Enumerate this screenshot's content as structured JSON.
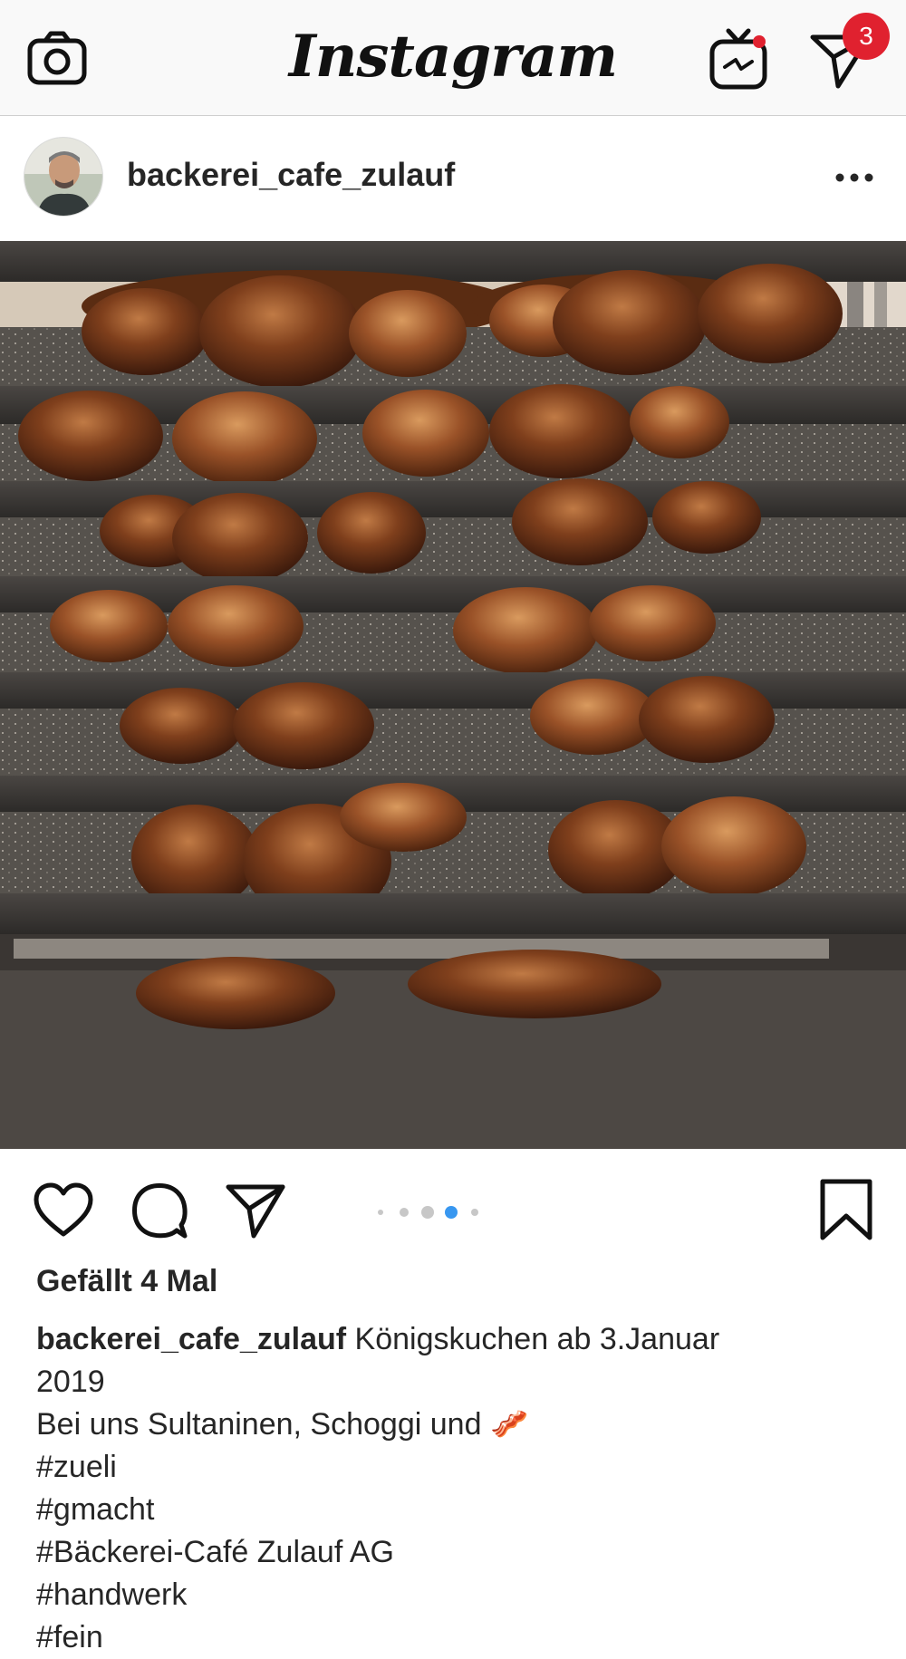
{
  "app": {
    "title": "Instagram",
    "notification_count": "3",
    "colors": {
      "badge": "#e0212f",
      "active_dot": "#3897f0",
      "text": "#262626"
    }
  },
  "icons": {
    "camera": "camera-icon",
    "igtv": "igtv-icon",
    "direct": "paper-plane-icon",
    "more": "more-dots-icon",
    "like": "heart-icon",
    "comment": "comment-bubble-icon",
    "share": "paper-plane-icon",
    "save": "bookmark-icon"
  },
  "post": {
    "username": "backerei_cafe_zulauf",
    "carousel": {
      "total": 5,
      "active_index": 3
    },
    "likes": "Gefällt 4 Mal",
    "caption": {
      "user": "backerei_cafe_zulauf",
      "text_first": " Königskuchen ab 3.Januar",
      "text_second": "2019",
      "line2": "Bei uns Sultaninen, Schoggi und",
      "emoji": "🥓",
      "hashtags": [
        "#zueli",
        "#gmacht",
        "#Bäckerei-Café Zulauf AG",
        "#handwerk",
        "#fein"
      ]
    }
  }
}
